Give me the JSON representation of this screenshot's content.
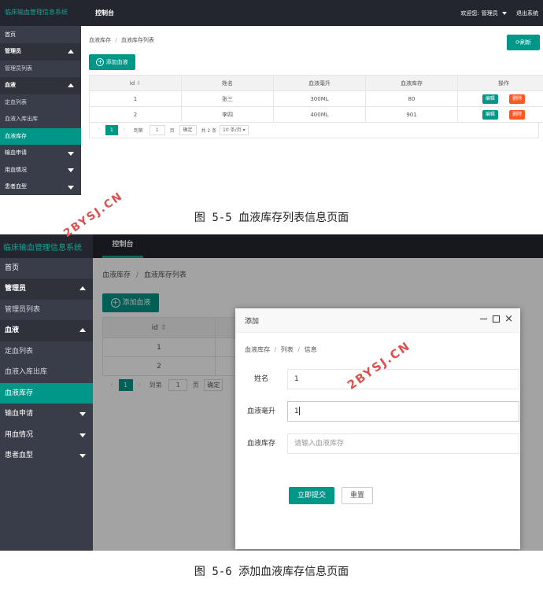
{
  "shared": {
    "brand": "临床输血管理信息系统",
    "tab_console": "控制台",
    "welcome": "欢迎您:",
    "user": "管理员",
    "logout": "退出系统",
    "sidebar": [
      {
        "label": "首页",
        "kind": "top"
      },
      {
        "label": "管理员",
        "kind": "group",
        "arrow": "up"
      },
      {
        "label": "管理员列表",
        "kind": "sub"
      },
      {
        "label": "血液",
        "kind": "group",
        "arrow": "up"
      },
      {
        "label": "定血列表",
        "kind": "sub"
      },
      {
        "label": "血液入库出库",
        "kind": "sub"
      },
      {
        "label": "血液库存",
        "kind": "active"
      },
      {
        "label": "输血申请",
        "kind": "top",
        "arrow": "down"
      },
      {
        "label": "用血情况",
        "kind": "top",
        "arrow": "down"
      },
      {
        "label": "患者血型",
        "kind": "top",
        "arrow": "down"
      }
    ],
    "breadcrumb": [
      "血液库存",
      "血液库存列表"
    ],
    "add_button": "添加血液",
    "refresh_button": "刷新"
  },
  "shot1": {
    "table": {
      "headers": [
        "id",
        "姓名",
        "血液毫升",
        "血液库存",
        "操作"
      ],
      "rows": [
        {
          "id": "1",
          "name": "张三",
          "ml": "300ML",
          "stock": "80"
        },
        {
          "id": "2",
          "name": "李四",
          "ml": "400ML",
          "stock": "901"
        }
      ],
      "edit": "编辑",
      "delete": "删除"
    },
    "pagination": {
      "current": "1",
      "goto": "到第",
      "page_input": "1",
      "page_unit": "页",
      "confirm": "确定",
      "total": "共 2 条",
      "per_page": "10 条/页"
    },
    "caption": "图 5-5 血液库存列表信息页面"
  },
  "shot2": {
    "table_header_id": "id",
    "rows": [
      "1",
      "2"
    ],
    "pagination": {
      "current": "1",
      "goto": "到第",
      "page_input": "1",
      "page_unit": "页",
      "confirm": "确定"
    },
    "modal": {
      "title": "添加",
      "breadcrumb": [
        "血液库存",
        "列表",
        "信息"
      ],
      "fields": [
        {
          "label": "姓名",
          "value": "1",
          "placeholder": ""
        },
        {
          "label": "血液毫升",
          "value": "1",
          "placeholder": ""
        },
        {
          "label": "血液库存",
          "value": "",
          "placeholder": "请输入血液库存"
        }
      ],
      "submit": "立即提交",
      "reset": "重置"
    },
    "caption": "图 5-6 添加血液库存信息页面"
  },
  "watermark": "2BYSJ.CN",
  "colors": {
    "teal": "#009688",
    "dark": "#23262e",
    "sidebar": "#393d49",
    "edit": "#1e9fff",
    "delete": "#ff5722"
  }
}
